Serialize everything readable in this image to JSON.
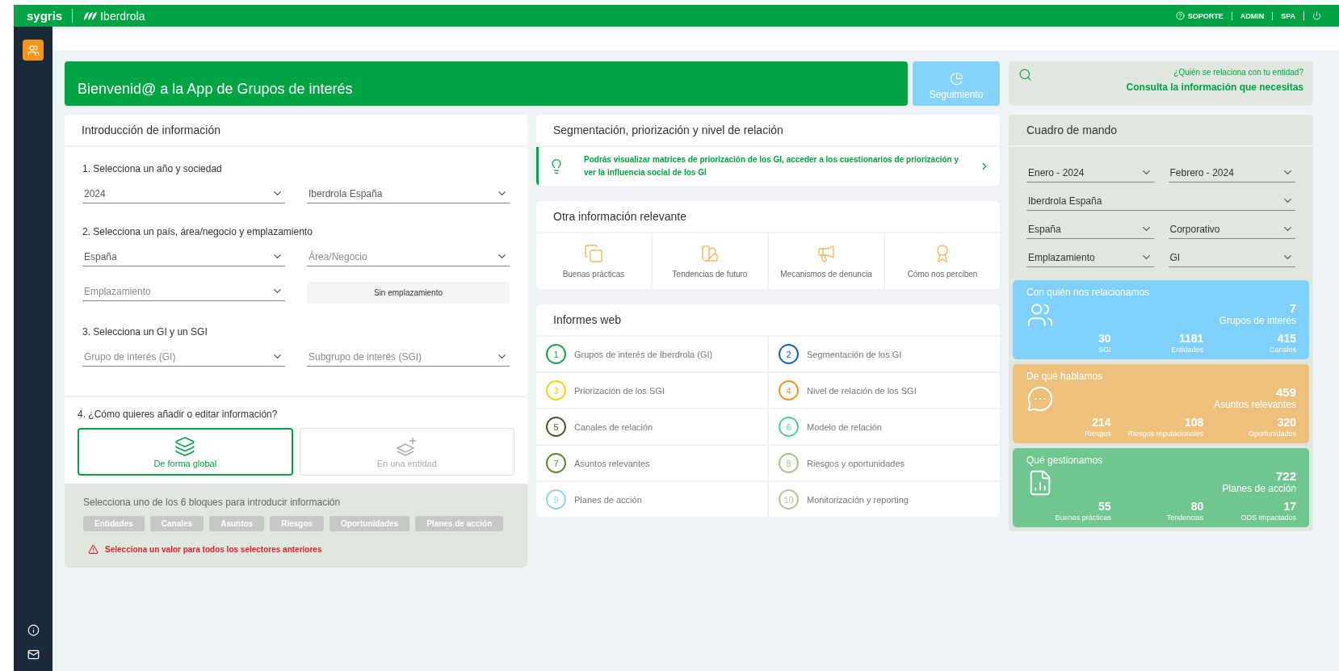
{
  "header": {
    "brand": "sygris",
    "partner": "Iberdrola",
    "support": "SOPORTE",
    "links": [
      "ADMIN",
      "SPA"
    ]
  },
  "sidebar": {
    "top_items": [
      {
        "kind": "people",
        "selected": true
      }
    ],
    "bottom_items": [
      {
        "kind": "info",
        "selected": false
      },
      {
        "kind": "mail",
        "selected": false
      }
    ]
  },
  "welcome": {
    "title": "Bienvenid@ a la App de Grupos de interés",
    "action": "Seguimiento"
  },
  "search_card": {
    "question": "¿Quién se relaciona con tu entidad?",
    "link": "Consulta la información que necesitas"
  },
  "intro": {
    "title": "Introducción de información",
    "steps": [
      {
        "label": "1. Selecciona un año y sociedad",
        "fields": [
          {
            "kind": "select",
            "value": "2024"
          },
          {
            "kind": "select",
            "value": "Iberdrola España"
          }
        ]
      },
      {
        "label": "2. Selecciona un país, área/negocio y emplazamiento",
        "fields": [
          {
            "kind": "select",
            "value": "España"
          },
          {
            "kind": "select",
            "placeholder": "Área/Negocio"
          },
          {
            "kind": "select",
            "placeholder": "Emplazamiento"
          },
          {
            "kind": "button",
            "value": "Sin emplazamiento"
          }
        ]
      },
      {
        "label": "3. Selecciona un GI y un SGI",
        "fields": [
          {
            "kind": "select",
            "placeholder": "Grupo de interés (GI)"
          },
          {
            "kind": "select",
            "placeholder": "Subgrupo de interés (SGI)"
          }
        ]
      }
    ],
    "mode": {
      "label": "4. ¿Cómo quieres añadir o editar información?",
      "options": [
        {
          "kind": "global",
          "label": "De forma global",
          "selected": true
        },
        {
          "kind": "entity",
          "label": "En una entidad",
          "selected": false
        }
      ]
    },
    "blocks": {
      "hint": "Selecciona uno de los 6 bloques para introducir información",
      "disabled": true,
      "buttons": [
        "Entidades",
        "Canales",
        "Asuntos",
        "Riesgos",
        "Oportunidades",
        "Planes de acción"
      ],
      "error": "Selecciona un valor para todos los selectores anteriores"
    }
  },
  "segmentation": {
    "title": "Segmentación, priorización y nivel de relación",
    "tip": "Podrás visualizar matrices de priorización de los GI, acceder a los cuestionarios de priorización y ver la influencia social de los GI"
  },
  "other_info": {
    "title": "Otra información relevante",
    "items": [
      {
        "kind": "copies",
        "label": "Buenas prácticas"
      },
      {
        "kind": "swatches",
        "label": "Tendencias de futuro"
      },
      {
        "kind": "megaphone",
        "label": "Mecanismos de denuncia"
      },
      {
        "kind": "award",
        "label": "Cómo nos perciben"
      }
    ]
  },
  "reports": {
    "title": "Informes web",
    "items": [
      {
        "number": "1",
        "label": "Grupos de interés de Iberdrola (GI)",
        "color": "#1aa34a"
      },
      {
        "number": "2",
        "label": "Segmentación de los GI",
        "color": "#1565c0"
      },
      {
        "number": "3",
        "label": "Priorización de los SGI",
        "color": "#f2d50c"
      },
      {
        "number": "4",
        "label": "Nivel de relación de los SGI",
        "color": "#f7931e"
      },
      {
        "number": "5",
        "label": "Canales de relación",
        "color": "#4a5a2a"
      },
      {
        "number": "6",
        "label": "Modelo de relación",
        "color": "#4fd08a"
      },
      {
        "number": "7",
        "label": "Asuntos relevantes",
        "color": "#5a8a2a"
      },
      {
        "number": "8",
        "label": "Riesgos y oportunidades",
        "color": "#a8c08a"
      },
      {
        "number": "9",
        "label": "Planes de acción",
        "color": "#8fd0f7"
      },
      {
        "number": "10",
        "label": "Monitorización y reporting",
        "color": "#b5c79a"
      }
    ]
  },
  "dashboard": {
    "title": "Cuadro de mando",
    "filters": [
      {
        "value": "Enero - 2024",
        "wide": false
      },
      {
        "value": "Febrero - 2024",
        "wide": false
      },
      {
        "value": "Iberdrola España",
        "wide": true
      },
      {
        "value": "España",
        "wide": false
      },
      {
        "value": "Corporativo",
        "wide": false
      },
      {
        "value": "Emplazamiento",
        "wide": false
      },
      {
        "value": "GI",
        "wide": false
      }
    ],
    "cards": [
      {
        "kind": "people",
        "color": "#80d0fc",
        "title": "Con quién nos relacionamos",
        "main": {
          "value": "7",
          "label": "Grupos de interés"
        },
        "stats": [
          {
            "value": "30",
            "label": "SGI"
          },
          {
            "value": "1181",
            "label": "Entidades"
          },
          {
            "value": "415",
            "label": "Canales"
          }
        ]
      },
      {
        "kind": "chat",
        "color": "#edc17c",
        "title": "De qué hablamos",
        "main": {
          "value": "459",
          "label": "Asuntos relevantes"
        },
        "stats": [
          {
            "value": "214",
            "label": "Riesgos"
          },
          {
            "value": "108",
            "label": "Riesgos reputacionales"
          },
          {
            "value": "320",
            "label": "Oportunidades"
          }
        ]
      },
      {
        "kind": "report",
        "color": "#6fc68f",
        "title": "Qué gestionamos",
        "main": {
          "value": "722",
          "label": "Planes de acción"
        },
        "stats": [
          {
            "value": "55",
            "label": "Buenas prácticas"
          },
          {
            "value": "80",
            "label": "Tendencias"
          },
          {
            "value": "17",
            "label": "ODS Impactados"
          }
        ]
      }
    ]
  }
}
